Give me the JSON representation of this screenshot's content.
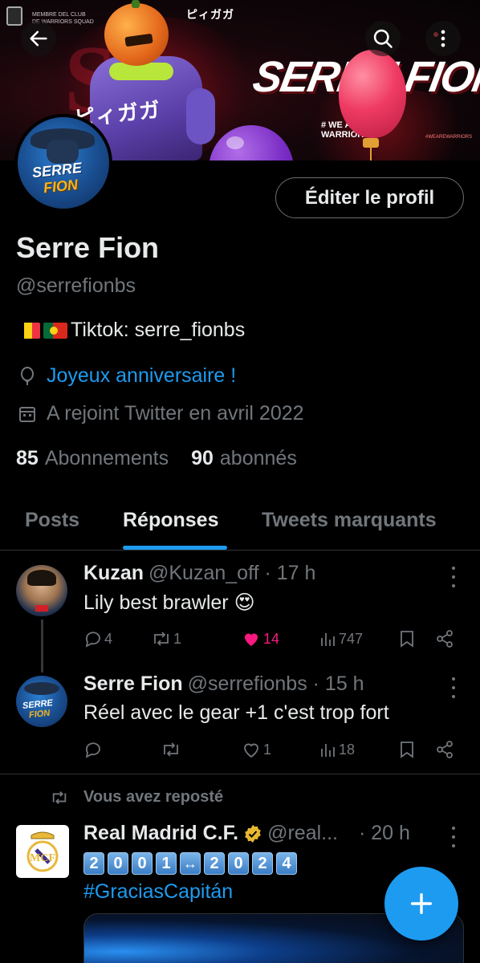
{
  "banner": {
    "title": "SERRE FION",
    "jp_top": "ピィガガ",
    "jp_side": "ピィガガ",
    "club": "MEMBRE DEL CLUB\nDE WARRIORS SQUAD",
    "hashtag": "# WE ARE\nWARRIORS",
    "hashtag2": "#WEAREWARRIORS"
  },
  "topbar": {
    "back_icon": "arrow-left-icon",
    "search_icon": "search-icon",
    "more_icon": "more-vertical-icon"
  },
  "avatar": {
    "text1": "SERRE",
    "text2": "FION"
  },
  "profile": {
    "edit_label": "Éditer le profil",
    "name": "Serre Fion",
    "handle": "@serrefionbs",
    "bio": "Tiktok: serre_fionbs",
    "birthday": "Joyeux anniversaire !",
    "joined": "A rejoint Twitter en avril 2022",
    "following_count": "85",
    "following_label": "Abonnements",
    "followers_count": "90",
    "followers_label": "abonnés"
  },
  "tabs": [
    {
      "label": "Posts",
      "active": false
    },
    {
      "label": "Réponses",
      "active": true
    },
    {
      "label": "Tweets marquants",
      "active": false
    }
  ],
  "tweets": [
    {
      "name": "Kuzan",
      "handle": "@Kuzan_off · 17 h",
      "text": "Lily best brawler",
      "emoji": "😍",
      "replies": "4",
      "retweets": "1",
      "likes": "14",
      "views": "747"
    },
    {
      "name": "Serre Fion",
      "handle": "@serrefionbs · 15 h",
      "text": "Réel avec le gear +1 c'est trop fort",
      "replies": "",
      "retweets": "",
      "likes": "1",
      "views": "18"
    }
  ],
  "repost": {
    "label": "Vous avez reposté",
    "name": "Real Madrid C.F.",
    "handle": "@real...",
    "time": "· 20 h",
    "digits_a": [
      "2",
      "0",
      "0",
      "1"
    ],
    "arrow": "↔",
    "digits_b": [
      "2",
      "0",
      "2",
      "4"
    ],
    "hashtag": "#GraciasCapitán"
  },
  "colors": {
    "accent": "#1d9bf0",
    "like": "#f91880",
    "muted": "#71767b",
    "text": "#e7e9ea"
  }
}
